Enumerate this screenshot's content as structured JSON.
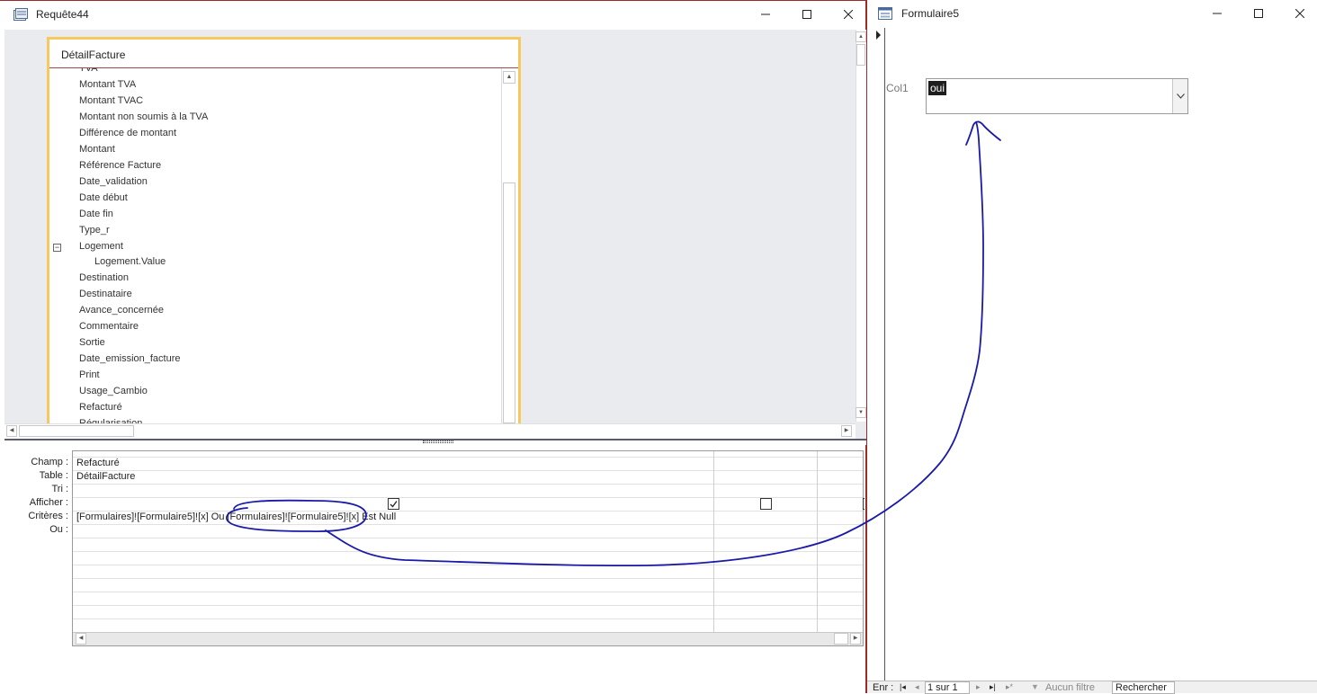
{
  "query_window": {
    "title": "Requête44",
    "table": {
      "name": "DétailFacture",
      "partial_top_field": "TVA",
      "fields": [
        {
          "label": "Montant TVA"
        },
        {
          "label": "Montant TVAC"
        },
        {
          "label": "Montant non soumis à la TVA"
        },
        {
          "label": "Différence de montant"
        },
        {
          "label": "Montant"
        },
        {
          "label": "Référence Facture"
        },
        {
          "label": "Date_validation"
        },
        {
          "label": "Date début"
        },
        {
          "label": "Date fin"
        },
        {
          "label": "Type_r"
        },
        {
          "label": "Logement",
          "collapse": "−"
        },
        {
          "label": "Logement.Value",
          "sub": true
        },
        {
          "label": "Destination"
        },
        {
          "label": "Destinataire"
        },
        {
          "label": "Avance_concernée"
        },
        {
          "label": "Commentaire"
        },
        {
          "label": "Sortie"
        },
        {
          "label": "Date_emission_facture"
        },
        {
          "label": "Print"
        },
        {
          "label": "Usage_Cambio"
        },
        {
          "label": "Refacturé"
        }
      ],
      "partial_bottom_field": "Régularisation"
    },
    "grid": {
      "row_labels": [
        "Champ :",
        "Table :",
        "Tri :",
        "Afficher :",
        "Critères :",
        "Ou :"
      ],
      "column1": {
        "champ": "Refacturé",
        "table": "DétailFacture",
        "afficher_checked": true,
        "criteres": "[Formulaires]![Formulaire5]![x] Ou [Formulaires]![Formulaire5]![x] Est Null"
      },
      "column2": {
        "afficher_checked": false
      }
    }
  },
  "form_window": {
    "title": "Formulaire5",
    "field_label": "Col1",
    "combo_value": "oui",
    "nav": {
      "prefix": "Enr :",
      "position": "1 sur 1",
      "filter": "Aucun filtre",
      "search": "Rechercher"
    }
  },
  "colors": {
    "annotation_ink": "#1a1aa8",
    "table_border": "#f6c85d",
    "window_border": "#9b2a2a"
  },
  "icons": [
    "query-icon",
    "form-icon",
    "minimize-icon",
    "maximize-icon",
    "close-icon"
  ]
}
